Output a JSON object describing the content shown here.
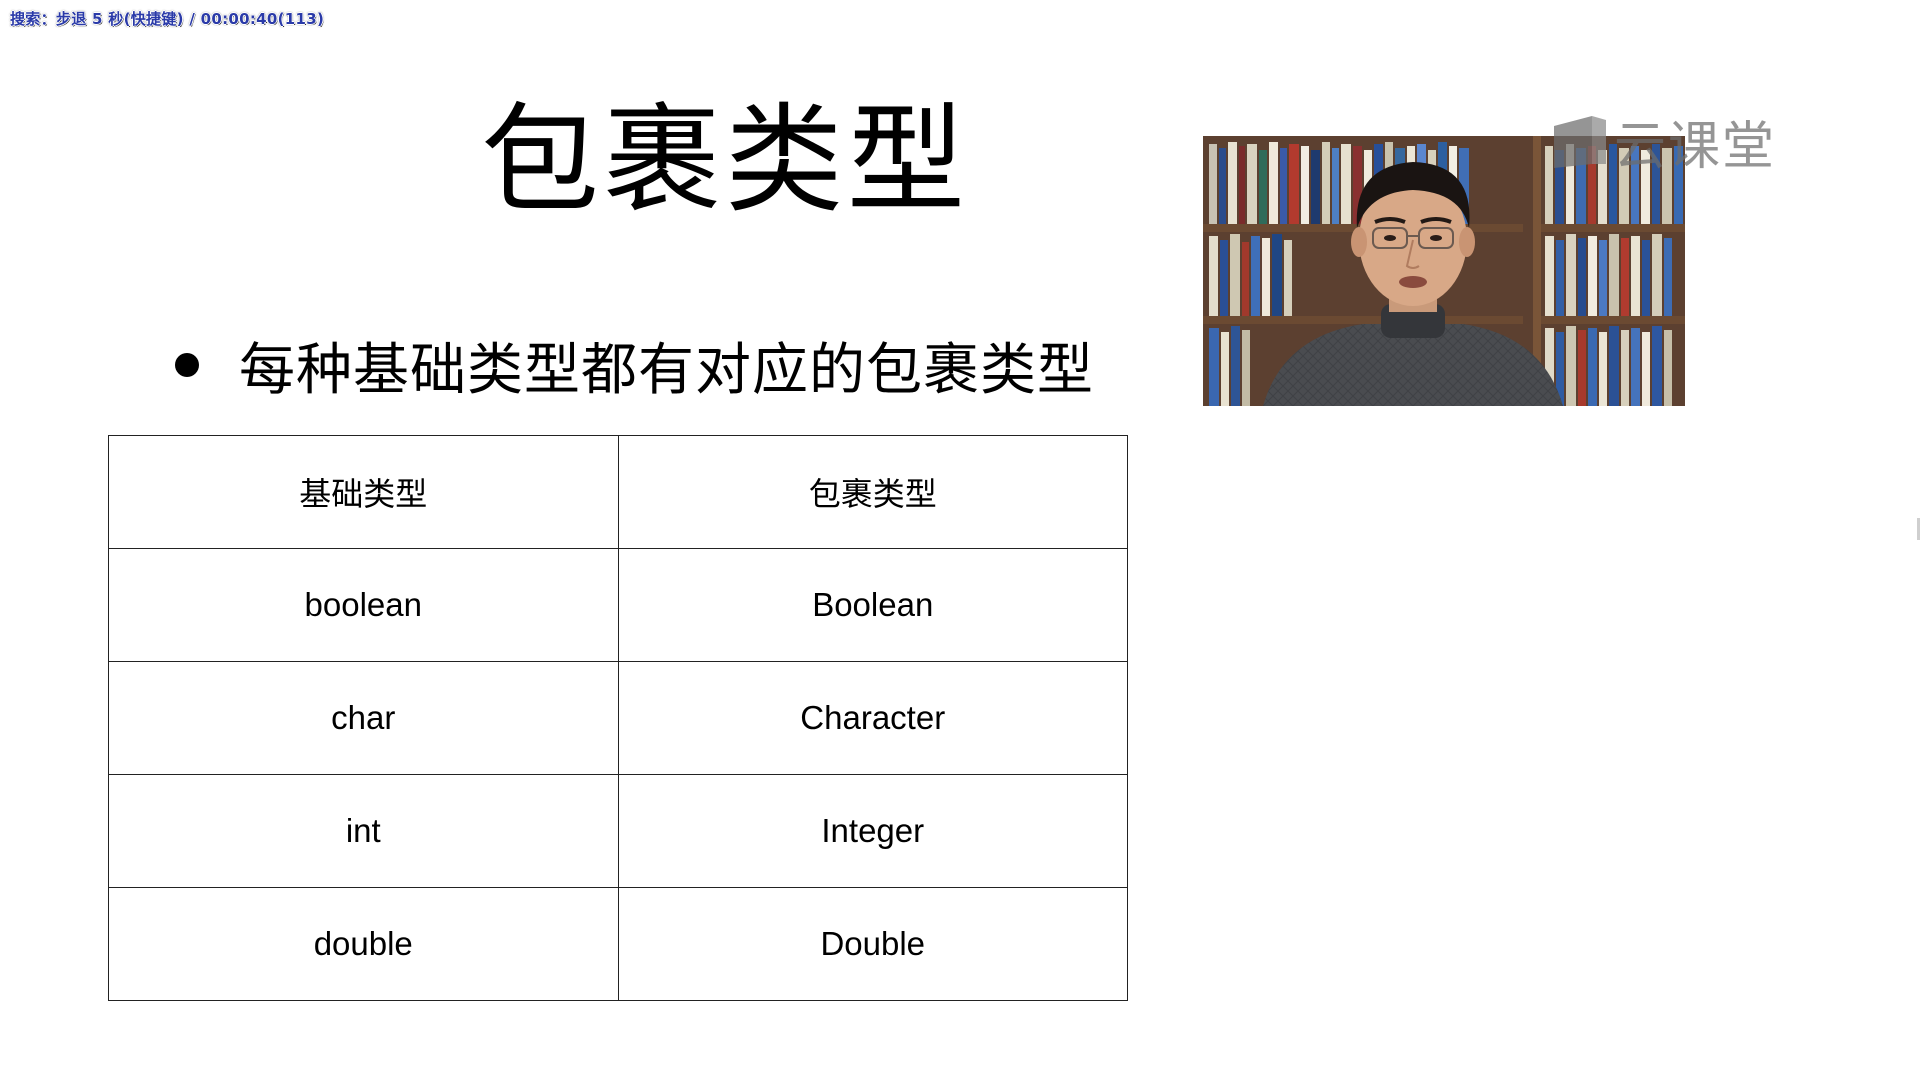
{
  "osd": {
    "status_text": "搜索：步退 5 秒(快捷键) / 00:00:40(113)"
  },
  "slide": {
    "title": "包裹类型",
    "bullet": "每种基础类型都有对应的包裹类型",
    "table": {
      "headers": [
        "基础类型",
        "包裹类型"
      ],
      "rows": [
        [
          "boolean",
          "Boolean"
        ],
        [
          "char",
          "Character"
        ],
        [
          "int",
          "Integer"
        ],
        [
          "double",
          "Double"
        ]
      ]
    }
  },
  "watermark": {
    "brand": "云课堂",
    "icon": "cloud-classroom-logo-icon"
  },
  "video": {
    "icon": "presenter-video-feed"
  },
  "colors": {
    "background": "#ffffff",
    "text": "#000000",
    "osd_text": "#2a3aa8",
    "watermark": "#6d6d6d"
  }
}
